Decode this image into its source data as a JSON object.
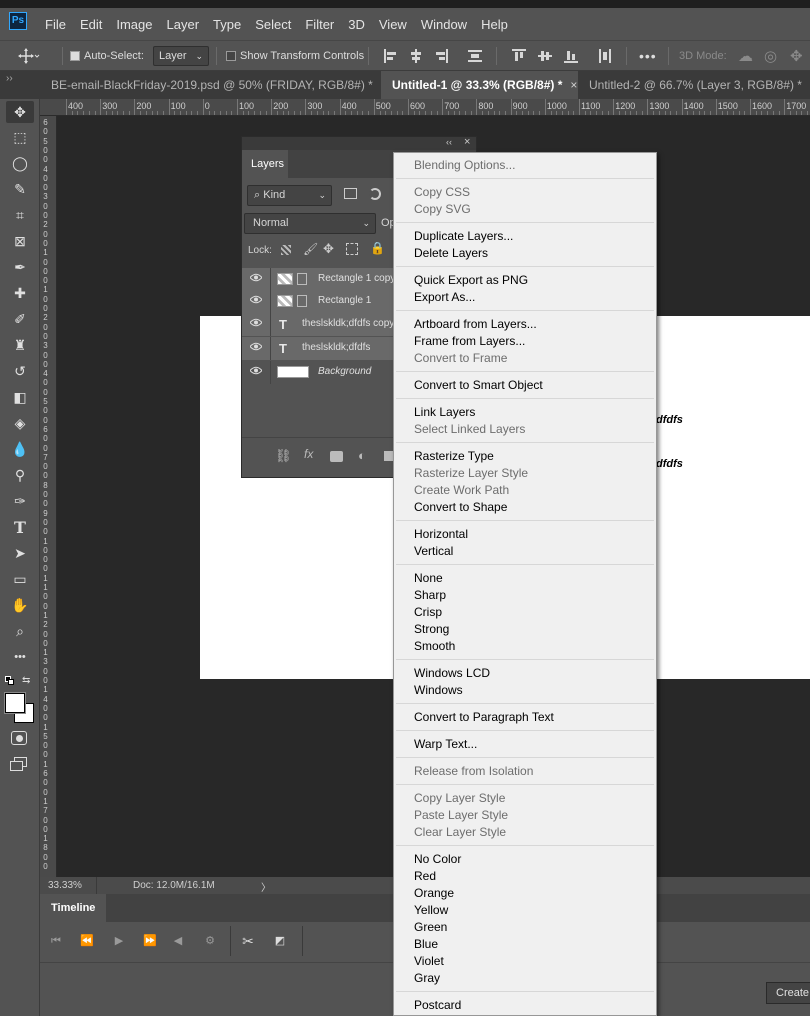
{
  "menubar": {
    "logo": "Ps",
    "items": [
      "File",
      "Edit",
      "Image",
      "Layer",
      "Type",
      "Select",
      "Filter",
      "3D",
      "View",
      "Window",
      "Help"
    ]
  },
  "options": {
    "auto_select_label": "Auto-Select:",
    "auto_select_checked": true,
    "auto_select_target": "Layer",
    "show_transform_label": "Show Transform Controls",
    "show_transform_checked": false,
    "mode_3d_label": "3D Mode:"
  },
  "panel_toggle": "››",
  "tabs": [
    {
      "label": "BE-email-BlackFriday-2019.psd @ 50% (FRIDAY, RGB/8#) *",
      "close": "×",
      "active": false
    },
    {
      "label": "Untitled-1 @ 33.3% (RGB/8#) *",
      "close": "×",
      "active": true
    },
    {
      "label": "Untitled-2 @ 66.7% (Layer 3, RGB/8#) *",
      "close": "×",
      "active": false
    }
  ],
  "ruler": {
    "h_labels": [
      "400",
      "300",
      "200",
      "100",
      "0",
      "100",
      "200",
      "300",
      "400",
      "500",
      "600",
      "700",
      "800",
      "900",
      "1000",
      "1100",
      "1200",
      "1300",
      "1400",
      "1500",
      "1600",
      "1700",
      "18"
    ],
    "v_labels": [
      "6",
      "0",
      "5",
      "0",
      "0",
      "4",
      "0",
      "0",
      "3",
      "0",
      "0",
      "2",
      "0",
      "0",
      "1",
      "0",
      "0",
      "0",
      "1",
      "0",
      "0",
      "2",
      "0",
      "0",
      "3",
      "0",
      "0",
      "4",
      "0",
      "0",
      "5",
      "0",
      "0",
      "6",
      "0",
      "0",
      "7",
      "0",
      "0",
      "8",
      "0",
      "0",
      "9",
      "0",
      "0",
      "1",
      "0",
      "0",
      "0",
      "1",
      "1",
      "0",
      "0",
      "1",
      "2",
      "0",
      "0",
      "1",
      "3",
      "0",
      "0",
      "1",
      "4",
      "0",
      "0",
      "1",
      "5",
      "0",
      "0",
      "1",
      "6",
      "0",
      "0",
      "1",
      "7",
      "0",
      "0",
      "1",
      "8",
      "0",
      "0"
    ]
  },
  "canvas": {
    "doc_text_1": "dfdfs",
    "doc_text_2": "dfdfs"
  },
  "status": {
    "zoom": "33.33%",
    "doc": "Doc: 12.0M/16.1M",
    "arrow": "〉"
  },
  "timeline": {
    "title": "Timeline",
    "create_label": "Create"
  },
  "layers_panel": {
    "title": "Layers",
    "collapse": "‹‹",
    "close": "×",
    "filter_kind": "Kind",
    "blend_mode": "Normal",
    "opacity_label": "Op",
    "lock_label": "Lock:",
    "layers": [
      {
        "name": "Rectangle 1 copy",
        "kind": "shape",
        "selected": true
      },
      {
        "name": "Rectangle 1",
        "kind": "shape",
        "selected": true
      },
      {
        "name": "theslskldk;dfdfs copy",
        "kind": "text",
        "selected": true
      },
      {
        "name": "theslskldk;dfdfs",
        "kind": "text",
        "selected": true
      },
      {
        "name": "Background",
        "kind": "background",
        "selected": false
      }
    ],
    "text_glyph": "T",
    "eye_glyph": "👁"
  },
  "context_menu": {
    "groups": [
      [
        {
          "label": "Blending Options...",
          "disabled": true
        }
      ],
      [
        {
          "label": "Copy CSS",
          "disabled": true
        },
        {
          "label": "Copy SVG",
          "disabled": true
        }
      ],
      [
        {
          "label": "Duplicate Layers...",
          "disabled": false
        },
        {
          "label": "Delete Layers",
          "disabled": false
        }
      ],
      [
        {
          "label": "Quick Export as PNG",
          "disabled": false
        },
        {
          "label": "Export As...",
          "disabled": false
        }
      ],
      [
        {
          "label": "Artboard from Layers...",
          "disabled": false
        },
        {
          "label": "Frame from Layers...",
          "disabled": false
        },
        {
          "label": "Convert to Frame",
          "disabled": true
        }
      ],
      [
        {
          "label": "Convert to Smart Object",
          "disabled": false
        }
      ],
      [
        {
          "label": "Link Layers",
          "disabled": false
        },
        {
          "label": "Select Linked Layers",
          "disabled": true
        }
      ],
      [
        {
          "label": "Rasterize Type",
          "disabled": false
        },
        {
          "label": "Rasterize Layer Style",
          "disabled": true
        },
        {
          "label": "Create Work Path",
          "disabled": true
        },
        {
          "label": "Convert to Shape",
          "disabled": false
        }
      ],
      [
        {
          "label": "Horizontal",
          "disabled": false
        },
        {
          "label": "Vertical",
          "disabled": false
        }
      ],
      [
        {
          "label": "None",
          "disabled": false
        },
        {
          "label": "Sharp",
          "disabled": false
        },
        {
          "label": "Crisp",
          "disabled": false
        },
        {
          "label": "Strong",
          "disabled": false
        },
        {
          "label": "Smooth",
          "disabled": false
        }
      ],
      [
        {
          "label": "Windows LCD",
          "disabled": false
        },
        {
          "label": "Windows",
          "disabled": false
        }
      ],
      [
        {
          "label": "Convert to Paragraph Text",
          "disabled": false
        }
      ],
      [
        {
          "label": "Warp Text...",
          "disabled": false
        }
      ],
      [
        {
          "label": "Release from Isolation",
          "disabled": true
        }
      ],
      [
        {
          "label": "Copy Layer Style",
          "disabled": true
        },
        {
          "label": "Paste Layer Style",
          "disabled": true
        },
        {
          "label": "Clear Layer Style",
          "disabled": true
        }
      ],
      [
        {
          "label": "No Color",
          "disabled": false
        },
        {
          "label": "Red",
          "disabled": false
        },
        {
          "label": "Orange",
          "disabled": false
        },
        {
          "label": "Yellow",
          "disabled": false
        },
        {
          "label": "Green",
          "disabled": false
        },
        {
          "label": "Blue",
          "disabled": false
        },
        {
          "label": "Violet",
          "disabled": false
        },
        {
          "label": "Gray",
          "disabled": false
        }
      ],
      [
        {
          "label": "Postcard",
          "disabled": false
        }
      ]
    ]
  },
  "tools": [
    {
      "name": "move-tool-icon",
      "glyph": "✥",
      "active": true
    },
    {
      "name": "marquee-tool-icon",
      "glyph": "⬚",
      "active": false
    },
    {
      "name": "lasso-tool-icon",
      "glyph": "◯",
      "active": false
    },
    {
      "name": "quick-selection-tool-icon",
      "glyph": "✎",
      "active": false
    },
    {
      "name": "crop-tool-icon",
      "glyph": "⌗",
      "active": false
    },
    {
      "name": "frame-tool-icon",
      "glyph": "⊠",
      "active": false
    },
    {
      "name": "eyedropper-tool-icon",
      "glyph": "✒",
      "active": false
    },
    {
      "name": "healing-brush-tool-icon",
      "glyph": "✚",
      "active": false
    },
    {
      "name": "brush-tool-icon",
      "glyph": "✐",
      "active": false
    },
    {
      "name": "clone-stamp-tool-icon",
      "glyph": "♜",
      "active": false
    },
    {
      "name": "history-brush-tool-icon",
      "glyph": "↺",
      "active": false
    },
    {
      "name": "eraser-tool-icon",
      "glyph": "◧",
      "active": false
    },
    {
      "name": "paint-bucket-tool-icon",
      "glyph": "◈",
      "active": false
    },
    {
      "name": "blur-tool-icon",
      "glyph": "💧",
      "active": false
    },
    {
      "name": "dodge-tool-icon",
      "glyph": "⚲",
      "active": false
    },
    {
      "name": "pen-tool-icon",
      "glyph": "✑",
      "active": false
    },
    {
      "name": "type-tool-icon",
      "glyph": "T",
      "active": false
    },
    {
      "name": "path-selection-tool-icon",
      "glyph": "➤",
      "active": false
    },
    {
      "name": "rectangle-tool-icon",
      "glyph": "▭",
      "active": false
    },
    {
      "name": "hand-tool-icon",
      "glyph": "✋",
      "active": false
    },
    {
      "name": "zoom-tool-icon",
      "glyph": "⌕",
      "active": false
    },
    {
      "name": "more-tools-icon",
      "glyph": "•••",
      "active": false
    }
  ],
  "colors": {
    "chrome": "#535353",
    "dark": "#282828",
    "menu_bg": "#f0f0f0",
    "accent": "#31a8ff"
  }
}
